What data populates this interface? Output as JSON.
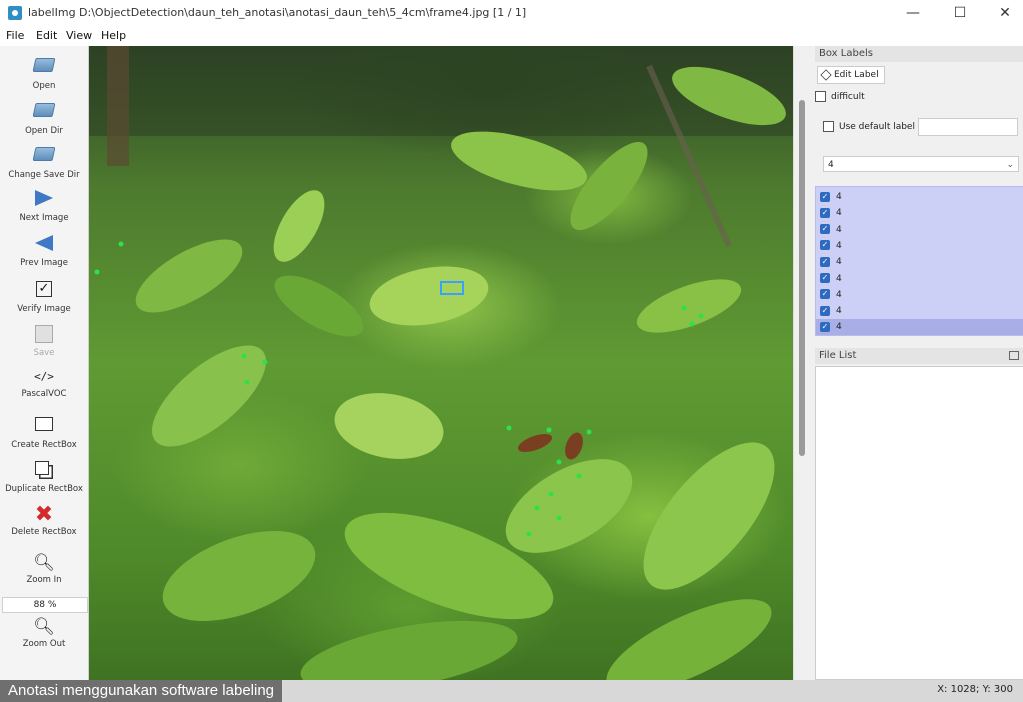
{
  "window": {
    "title": "labelImg D:\\ObjectDetection\\daun_teh_anotasi\\anotasi_daun_teh\\5_4cm\\frame4.jpg [1 / 1]",
    "minimize": "—",
    "maximize": "☐",
    "close": "✕"
  },
  "menu": [
    "File",
    "Edit",
    "View",
    "Help"
  ],
  "toolbar": {
    "open": "Open",
    "open_dir": "Open Dir",
    "change_save_dir": "Change Save Dir",
    "next_image": "Next Image",
    "prev_image": "Prev Image",
    "verify_image": "Verify Image",
    "save": "Save",
    "format_icon": "</>",
    "format": "PascalVOC",
    "create_rectbox": "Create RectBox",
    "duplicate_rectbox": "Duplicate RectBox",
    "delete_rectbox": "Delete RectBox",
    "zoom_in": "Zoom In",
    "zoom_level": "88 %",
    "zoom_out": "Zoom Out"
  },
  "box_labels": {
    "title": "Box Labels",
    "edit_label": "Edit Label",
    "difficult": "difficult",
    "use_default_label": "Use default label",
    "default_label_value": "",
    "combo_value": "4",
    "items": [
      "4",
      "4",
      "4",
      "4",
      "4",
      "4",
      "4",
      "4",
      "4"
    ],
    "selected_index": 8
  },
  "file_list": {
    "title": "File List"
  },
  "status": {
    "caption": "Anotasi menggunakan software labeling",
    "coordinates": "X: 1028; Y: 300"
  },
  "colors": {
    "label_list_bg": "#ccd0f6",
    "label_selected": "#a9aee6",
    "checkbox_checked": "#2c6bbf",
    "annotation_point": "#2ee04a",
    "selected_box": "#3aa0ff"
  }
}
